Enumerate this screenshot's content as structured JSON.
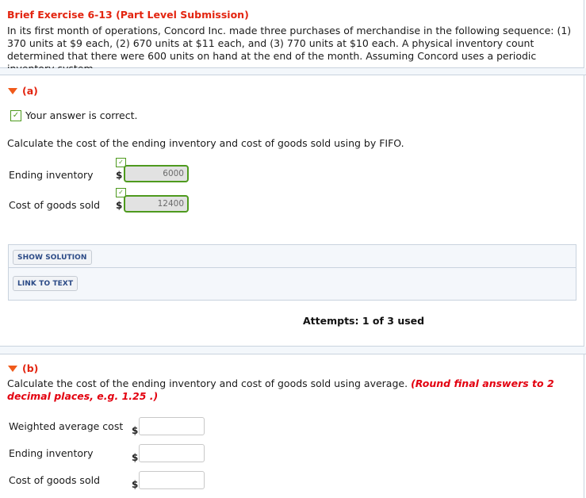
{
  "header": {
    "title": "Brief Exercise 6-13 (Part Level Submission)",
    "question": "In its first month of operations, Concord Inc. made three purchases of merchandise in the following sequence: (1) 370 units at $9 each, (2) 670 units at $11 each, and (3) 770 units at $10 each. A physical inventory count determined that there were 600 units on hand at the end of the month. Assuming Concord uses a periodic inventory system."
  },
  "part_a": {
    "label": "(a)",
    "status": "Your answer is correct.",
    "instruction": "Calculate the cost of the ending inventory and cost of goods sold using by FIFO.",
    "rows": [
      {
        "label": "Ending inventory",
        "currency": "$",
        "value": "6000",
        "correct": true
      },
      {
        "label": "Cost of goods sold",
        "currency": "$",
        "value": "12400",
        "correct": true
      }
    ],
    "buttons": {
      "show_solution": "SHOW SOLUTION",
      "link_to_text": "LINK TO TEXT"
    },
    "attempts": "Attempts: 1 of 3 used"
  },
  "part_b": {
    "label": "(b)",
    "instruction": "Calculate the cost of the ending inventory and cost of goods sold using average.",
    "hint": "(Round final answers to 2 decimal places, e.g. 1.25 .)",
    "rows": [
      {
        "label": "Weighted average cost",
        "currency": "$",
        "value": ""
      },
      {
        "label": "Ending inventory",
        "currency": "$",
        "value": ""
      },
      {
        "label": "Cost of goods sold",
        "currency": "$",
        "value": ""
      }
    ]
  },
  "colors": {
    "title_red": "#e3240f",
    "correct_green": "#4e9a1e",
    "button_text_blue": "#2b4a86",
    "hint_red": "#e3000f"
  }
}
